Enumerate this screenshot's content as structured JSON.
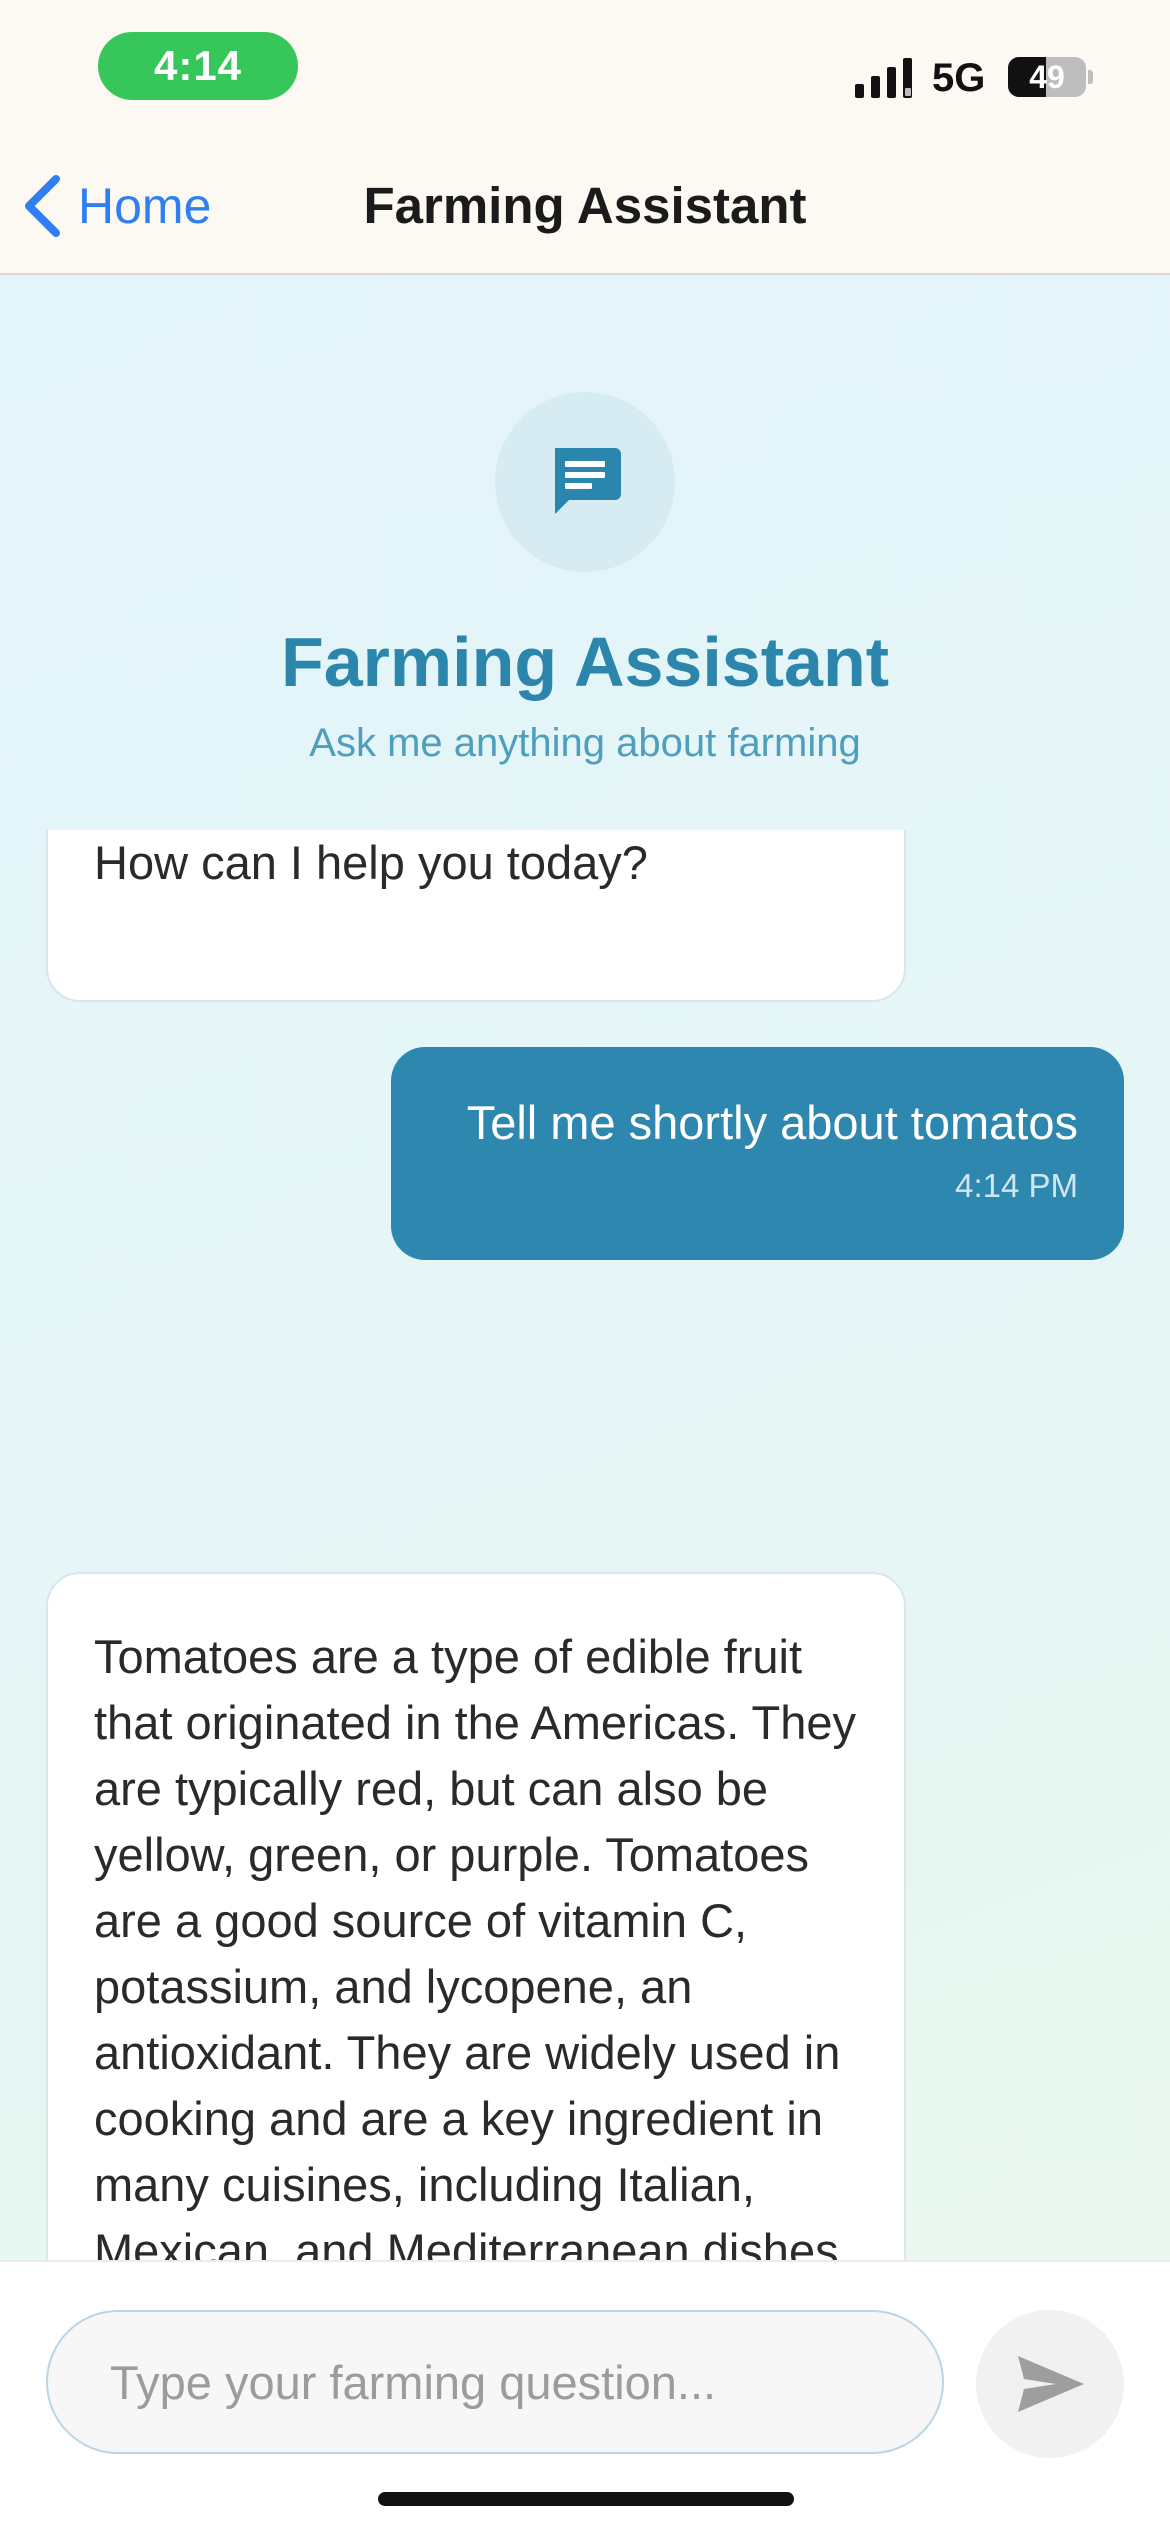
{
  "status_bar": {
    "time": "4:14",
    "network": "5G",
    "battery_level": "49",
    "battery_fraction": 0.49,
    "icons": {
      "signal": "cellular-signal-icon",
      "battery": "battery-icon"
    }
  },
  "nav": {
    "back_label": "Home",
    "title": "Farming Assistant",
    "icons": {
      "back": "chevron-left-icon"
    }
  },
  "header": {
    "icon": "chat-bubble-icon",
    "title": "Farming Assistant",
    "subtitle": "Ask me anything about farming"
  },
  "messages": [
    {
      "role": "assistant",
      "text": "How can I help you today?"
    },
    {
      "role": "user",
      "text": "Tell me shortly about tomatos",
      "time": "4:14 PM"
    },
    {
      "role": "assistant",
      "text": "Tomatoes are a type of edible fruit that originated in the Americas. They are typically red, but can also be yellow, green, or purple. Tomatoes are a good source of vitamin C, potassium, and lycopene, an antioxidant. They are widely used in cooking and are a key ingredient in many cuisines, including Italian, Mexican, and Mediterranean dishes."
    }
  ],
  "input": {
    "placeholder": "Type your farming question...",
    "value": "",
    "send_icon": "send-icon"
  },
  "colors": {
    "accent": "#2d87ae",
    "ios_blue": "#2f7ff2",
    "time_pill": "#36c659",
    "bot_bubble": "#ffffff",
    "user_bubble": "#2d87ae"
  }
}
